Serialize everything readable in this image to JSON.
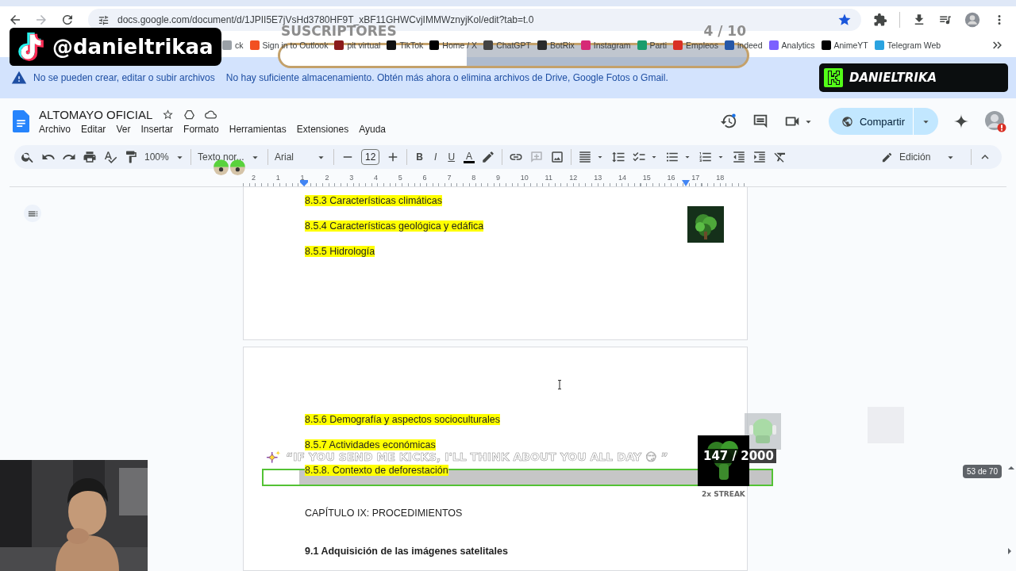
{
  "browser": {
    "url": "docs.google.com/document/d/1JPII5E7jVsHd3780HF9T_xBF11GHWCvjIMMWznyjKol/edit?tab=t.0",
    "bookmarked": true,
    "bookmarks": [
      {
        "label": "ck",
        "color": "#9aa0a6"
      },
      {
        "label": "Sign in to Outlook",
        "color": "#f25022"
      },
      {
        "label": "pit virtual",
        "color": "#8b1a1a"
      },
      {
        "label": "TikTok",
        "color": "#111111"
      },
      {
        "label": "Home / X",
        "color": "#000000"
      },
      {
        "label": "ChatGPT",
        "color": "#444444"
      },
      {
        "label": "BotRix",
        "color": "#2b2b2b"
      },
      {
        "label": "Instagram",
        "color": "#d62976"
      },
      {
        "label": "Parti",
        "color": "#1a9c6b"
      },
      {
        "label": "Empleos",
        "color": "#d93025"
      },
      {
        "label": "indeed",
        "color": "#2557a7"
      },
      {
        "label": "Analytics",
        "color": "#7b61ff"
      },
      {
        "label": "AnimeYT",
        "color": "#000000"
      },
      {
        "label": "Telegram Web",
        "color": "#2aa3e0"
      }
    ]
  },
  "warning": {
    "title": "No se pueden crear, editar o subir archivos",
    "message": "No hay suficiente almacenamiento. Obtén más ahora o elimina archivos de Drive, Google Fotos o Gmail."
  },
  "document": {
    "title": "ALTOMAYO OFICIAL",
    "starred": false,
    "menu": [
      "Archivo",
      "Editar",
      "Ver",
      "Insertar",
      "Formato",
      "Herramientas",
      "Extensiones",
      "Ayuda"
    ],
    "share": "Compartir"
  },
  "toolbar": {
    "zoom": "100%",
    "style": "Texto nor...",
    "font": "Arial",
    "size": "12",
    "format_buttons": [
      {
        "label": "B"
      },
      {
        "label": "I"
      },
      {
        "label": "U"
      },
      {
        "label": "A"
      }
    ],
    "mode": "Edición"
  },
  "ruler": [
    "2",
    "1",
    "1",
    "2",
    "3",
    "4",
    "5",
    "6",
    "7",
    "8",
    "9",
    "10",
    "11",
    "12",
    "13",
    "14",
    "15",
    "16",
    "17",
    "18"
  ],
  "pages": [
    {
      "paragraphs": [
        {
          "text": "8.5.3 Características climáticas",
          "kind": "heading",
          "highlighted": true
        },
        {
          "text": "8.5.4 Características geológica y edáfica",
          "kind": "heading",
          "highlighted": true
        },
        {
          "text": "8.5.5 Hidrología",
          "kind": "heading",
          "highlighted": true
        }
      ],
      "image": {
        "kind": "picture"
      }
    },
    {
      "paragraphs": [
        {
          "text": "8.5.6 Demografía y aspectos socioculturales",
          "kind": "heading",
          "highlighted": true
        },
        {
          "text": "8.5.7 Actividades económicas",
          "kind": "heading",
          "highlighted": true
        },
        {
          "text": "8.5.8. Contexto de deforestación",
          "kind": "heading",
          "highlighted": true
        },
        {
          "text": "CAPÍTULO IX: PROCEDIMIENTOS",
          "kind": "chapter",
          "highlighted": false
        },
        {
          "text": "9.1 Adquisición de las imágenes satelitales",
          "kind": "section",
          "highlighted": false
        }
      ]
    }
  ],
  "page_badge": "53 de 70",
  "overlays": {
    "tiktok_handle": "@danieltrikaa",
    "kick_name": "DANIELTRIKA",
    "subscriber_goal": {
      "label": "SUSCRIPTORES",
      "count": "4  / 10",
      "level": 0.4
    },
    "kick_goal": {
      "message": "“IF YOU SEND ME KICKS, I'LL THINK ABOUT YOU ALL DAY 😏 ”",
      "count": "147  / 2000",
      "streak": "2x STREAK",
      "level": 0.07
    },
    "webcam": {
      "kind": "picture"
    }
  }
}
